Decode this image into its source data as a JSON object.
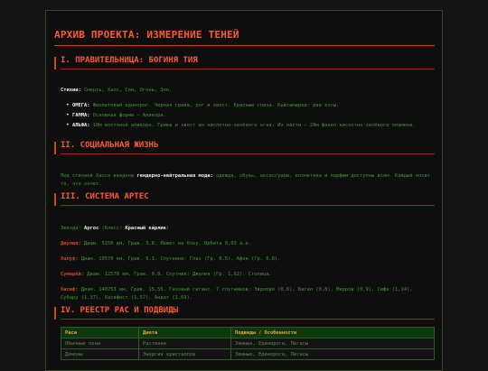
{
  "title": "АРХИВ ПРОЕКТА: ИЗМЕРЕНИЕ ТЕНЕЙ",
  "sections": [
    {
      "title": "I. ПРАВИТЕЛЬНИЦА: БОГИНЯ ТИЯ",
      "stikhii_label": "Стихии:",
      "stikhii_value": "Смерть, Хаос, Сон, Огонь, Зло.",
      "bullets": [
        {
          "label": "ОМЕГА:",
          "text": "Фиолетовый единорог. Черная грива, рог и хвост. Красные глаза. Кьютимарка: две косы."
        },
        {
          "label": "ГАММА:",
          "text": "Основная форма — Аликорн."
        },
        {
          "label": "АЛЬФА:",
          "text": "10м костяной аликорн. Грива и хвост из кислотно-зелёного огня. Из пасти — 20м факел кислотно-зелёного пламени."
        }
      ]
    },
    {
      "title": "II. СОЦИАЛЬНАЯ ЖИЗНЬ",
      "text_before": "Под стихией Хаоса введена ",
      "highlight": "гендерно-нейтральная мода:",
      "text_after": " одежда, обувь, аксессуары, косметика и парфюм доступны всем. Каждый носит то, что хочет."
    },
    {
      "title": "III. СИСТЕМА АРТЕС",
      "star_prefix": "Звезда: ",
      "star_name": "Аргос",
      "star_class_prefix": " (Класс: ",
      "star_class": "Красный карлик",
      "star_class_suffix": ")",
      "planets": [
        {
          "label": "Джулия:",
          "text": "Диам. 5150 км, Грав. 3,8. Лежит на боку. Орбита 0,03 а.е."
        },
        {
          "label": "Халуф:",
          "text": "Диам. 10570 км, Грав. 9,3. Спутники: Глаз (Гр. 0,5), Афон (Гр. 0,8)."
        },
        {
          "label": "Сумерки:",
          "text": "Диам. 12570 км, Грав. 9,8. Спутник: Джулия (Гр. 1,62). Столица."
        },
        {
          "label": "Хасиф:",
          "text": "Диам. 140753 км, Грав. 15,55. Газовый гигант. 7 спутников: Эвропия (0,6), Багал (0,8), Мирров (0,9), Сифа (1,14), Субару (1,37), Хасифист (1,57), Андат (1,69)."
        }
      ]
    },
    {
      "title": "IV. РЕЕСТР РАС И ПОДВИДЫ",
      "table": {
        "headers": [
          "Раса",
          "Диета",
          "Подвиды / Особенности"
        ],
        "rows": [
          [
            "Обычные пони",
            "Растения",
            "Земные, Единороги, Пегасы"
          ],
          [
            "Демоны",
            "Энергия кристаллов",
            "Земные, Единороги, Пегасы"
          ]
        ]
      }
    }
  ],
  "colors": {
    "accent": "#ff5a2e",
    "body_text": "#3c9b2c",
    "background": "#0e0e0e",
    "table_header_text": "#f0a030"
  }
}
